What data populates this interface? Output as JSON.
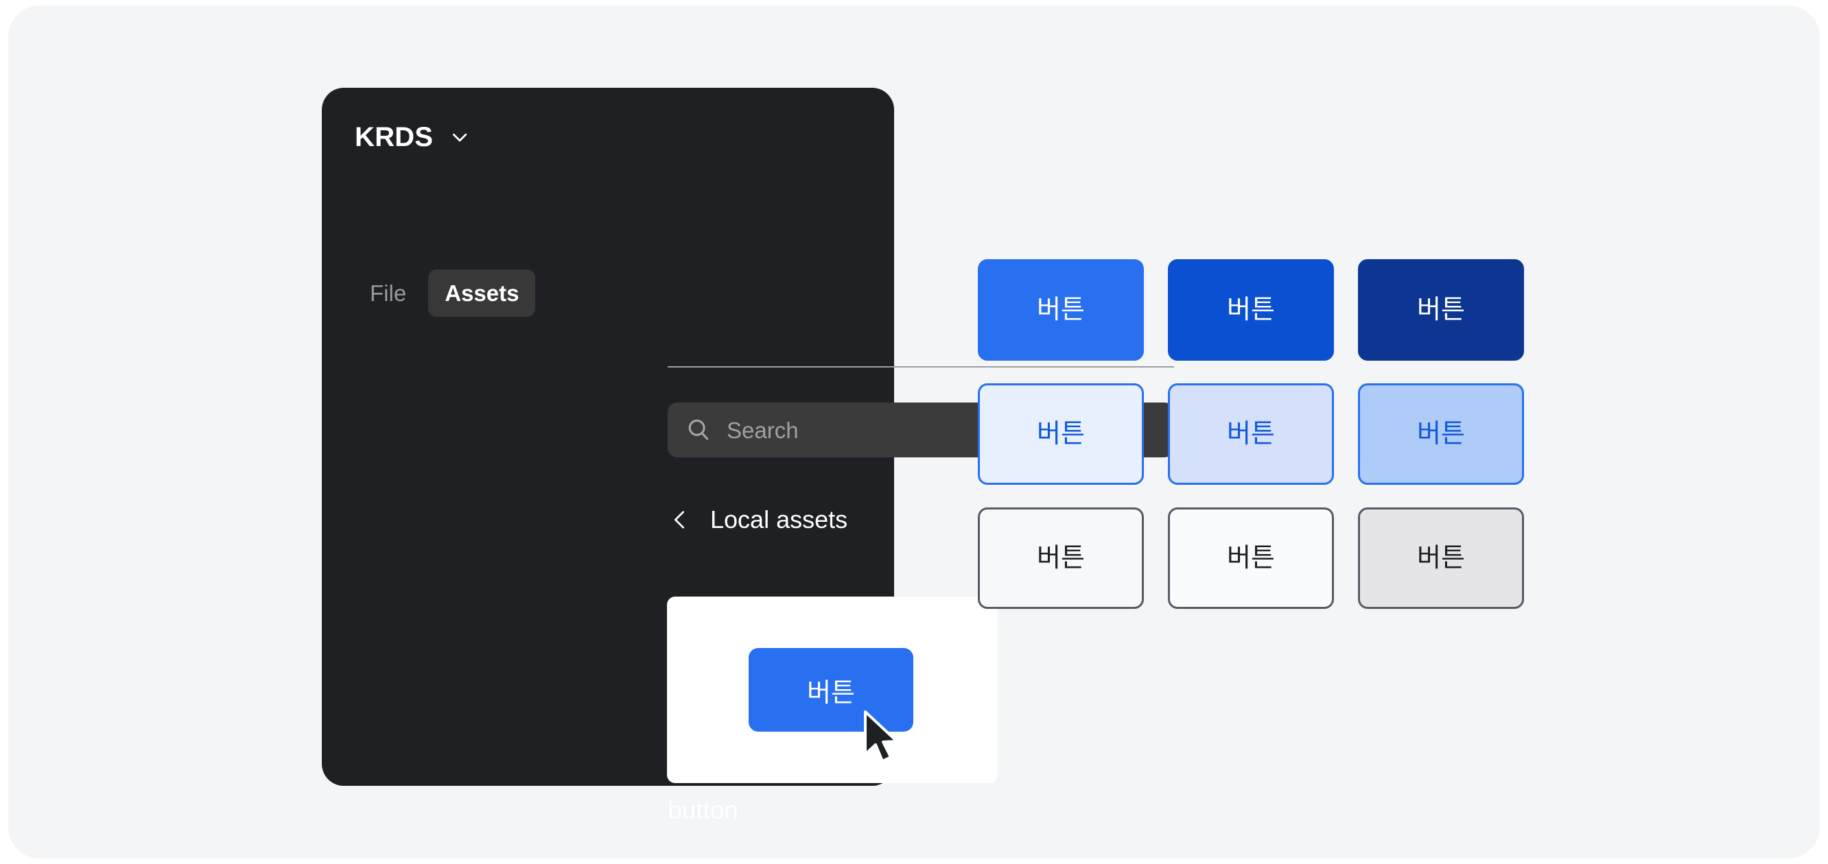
{
  "page": {
    "background": "#FFFFFF",
    "canvas_background": "#F3F5F7"
  },
  "assets_panel": {
    "background": "#1E2023",
    "title": "KRDS",
    "dropdown_icon": "chevron-down-icon",
    "tabs": [
      {
        "label": "File",
        "active": false
      },
      {
        "label": "Assets",
        "active": true
      }
    ],
    "active_tab_background": "#383838",
    "search": {
      "placeholder": "Search",
      "value": "",
      "icon": "search-icon",
      "background": "#3B3B3B"
    },
    "breadcrumb": {
      "back_icon": "chevron-left-icon",
      "label": "Local assets"
    },
    "asset_item": {
      "name": "button",
      "thumbnail_label": "버튼",
      "thumbnail_color": "#2870F0",
      "thumbnail_background": "#FFFFFF",
      "cursor_icon": "mouse-pointer-icon"
    }
  },
  "button_showcase": {
    "label": "버튼",
    "rows": [
      {
        "name": "primary-filled",
        "buttons": [
          {
            "state": "default",
            "label": "버튼",
            "fill": "#2870F0",
            "border": "#2870F0",
            "text": "#FFFFFF"
          },
          {
            "state": "hover",
            "label": "버튼",
            "fill": "#0B50D0",
            "border": "#0B50D0",
            "text": "#FFFFFF"
          },
          {
            "state": "pressed",
            "label": "버튼",
            "fill": "#0D3692",
            "border": "#0D3692",
            "text": "#FFFFFF"
          }
        ]
      },
      {
        "name": "secondary-tonal",
        "buttons": [
          {
            "state": "default",
            "label": "버튼",
            "fill": "#E8F0FD",
            "border": "#2870F0",
            "text": "#1059D8"
          },
          {
            "state": "hover",
            "label": "버튼",
            "fill": "#D5E0FA",
            "border": "#2870F0",
            "text": "#1059D8"
          },
          {
            "state": "pressed",
            "label": "버튼",
            "fill": "#AFCCF8",
            "border": "#2870F0",
            "text": "#1059D8"
          }
        ]
      },
      {
        "name": "tertiary-outline",
        "buttons": [
          {
            "state": "default",
            "label": "버튼",
            "fill": "#F7F8F9",
            "border": "#555C66",
            "text": "#1E2124"
          },
          {
            "state": "hover",
            "label": "버튼",
            "fill": "#FAFBFC",
            "border": "#555C66",
            "text": "#1E2124"
          },
          {
            "state": "pressed",
            "label": "버튼",
            "fill": "#E5E5E7",
            "border": "#555C66",
            "text": "#1E2124"
          }
        ]
      }
    ]
  }
}
